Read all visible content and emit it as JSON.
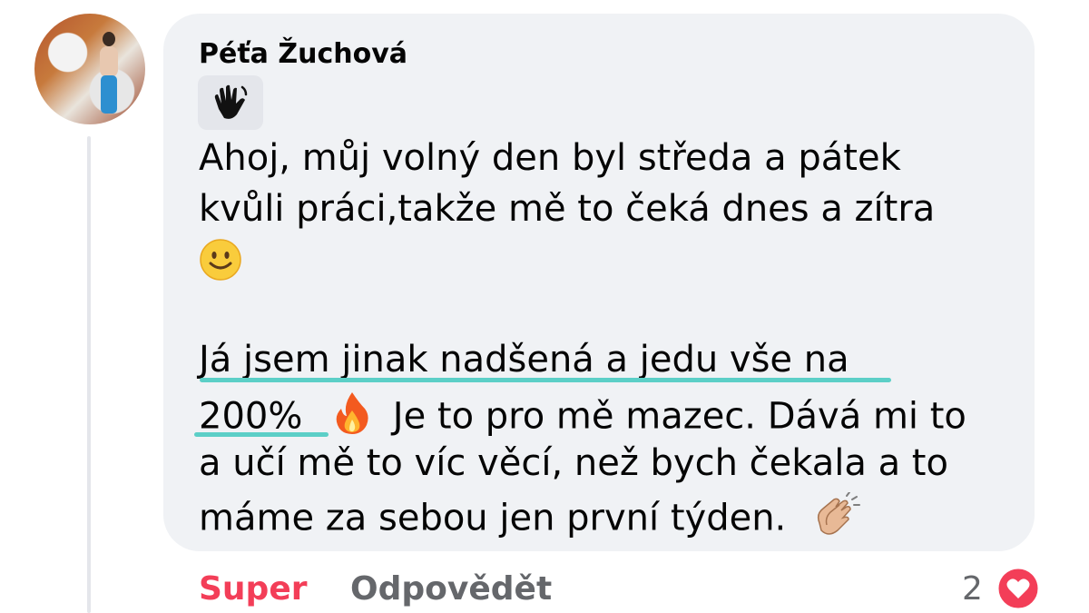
{
  "comment": {
    "author": "Péťa Žuchová",
    "lines": [
      "Ahoj, můj volný den byl středa a pátek",
      "kvůli práci,takže mě to čeká dnes a zítra",
      "",
      "Já jsem jinak nadšená a jedu vše na",
      "200%",
      "Je to pro mě mazec. Dává mi to",
      "a učí mě to víc věcí, než bych čekala a to",
      "máme za sebou jen první týden."
    ],
    "icons": [
      "waving-hand-icon",
      "smiling-face-icon",
      "fire-icon",
      "clapping-hands-icon"
    ]
  },
  "actions": {
    "like_label": "Super",
    "reply_label": "Odpovědět"
  },
  "reactions": {
    "count": "2",
    "icon": "heart-icon",
    "color": "#f33e58"
  },
  "colors": {
    "bubble": "#f0f2f5",
    "highlight": "#5ccfc7"
  }
}
